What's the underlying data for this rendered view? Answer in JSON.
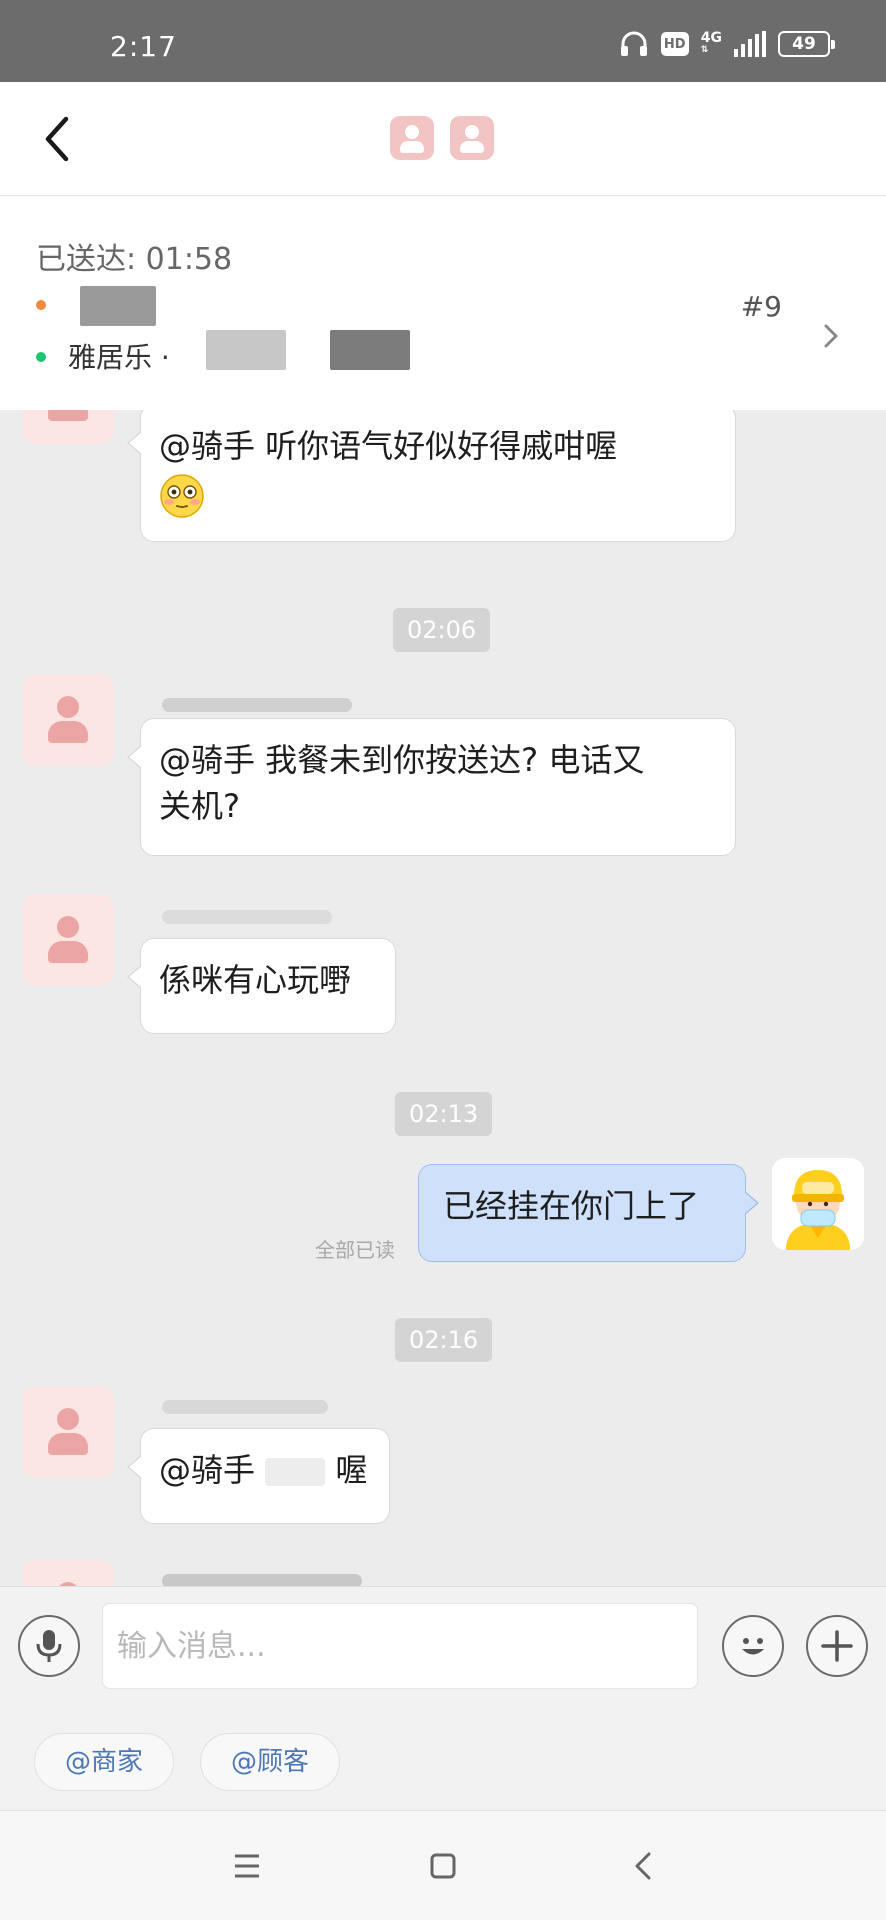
{
  "status_bar": {
    "time": "2:17",
    "network": "4G",
    "hd": "HD",
    "battery": "49"
  },
  "order": {
    "delivered_label": "已送达: 01:58",
    "store_name": "雅居乐 ·",
    "order_number": "#9",
    "dot_colors": {
      "customer": "#f08a3c",
      "store": "#1fc46f"
    }
  },
  "messages": [
    {
      "id": "m1",
      "side": "left",
      "text": "@骑手 听你语气好似好得戚咁喔",
      "emoji": "flushed-face"
    },
    {
      "id": "t1",
      "type": "time",
      "text": "02:06"
    },
    {
      "id": "m2",
      "side": "left",
      "line1": "@骑手 我餐未到你按送达? 电话又",
      "line2": "关机?"
    },
    {
      "id": "m3",
      "side": "left",
      "text": "係咪有心玩嘢"
    },
    {
      "id": "t2",
      "type": "time",
      "text": "02:13"
    },
    {
      "id": "m4",
      "side": "right",
      "text": "已经挂在你门上了",
      "read_status": "全部已读"
    },
    {
      "id": "t3",
      "type": "time",
      "text": "02:16"
    },
    {
      "id": "m5",
      "side": "left",
      "prefix": "@骑手",
      "suffix": "喔"
    }
  ],
  "input": {
    "placeholder": "输入消息..."
  },
  "quick_mentions": [
    "@商家",
    "@顾客"
  ],
  "icons": {
    "back": "back-arrow-icon",
    "chevron": "chevron-right-icon",
    "voice": "microphone-icon",
    "emoji": "smiley-icon",
    "add": "plus-icon",
    "nav_menu": "menu-icon",
    "nav_home": "square-icon",
    "nav_back": "back-triangle-icon"
  },
  "colors": {
    "bubble_self": "#cfe0fb",
    "bubble_other": "#ffffff",
    "mention_text": "#4d78b5",
    "avatar_bg": "#fbe6e3"
  }
}
